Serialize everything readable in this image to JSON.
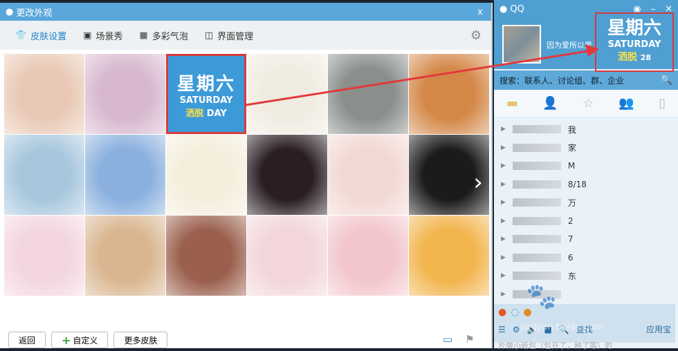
{
  "skin_window": {
    "title": "更改外观",
    "close": "x",
    "tabs": [
      {
        "label": "皮肤设置",
        "icon": "shirt-icon"
      },
      {
        "label": "场景秀",
        "icon": "image-icon"
      },
      {
        "label": "多彩气泡",
        "icon": "bubble-icon"
      },
      {
        "label": "界面管理",
        "icon": "layout-icon"
      }
    ],
    "selected_skin": {
      "line1": "星期六",
      "line2": "SATURDAY",
      "line3a": "洒脱",
      "line3b": " DAY"
    },
    "tiles": [
      "#e9c9b6",
      "#d7b8cf",
      "#3d9ad9",
      "#f1ece2",
      "#8a8f8c",
      "#d48848",
      "#a8c7dd",
      "#8ab0de",
      "#f4eedc",
      "#2a1e24",
      "#f2d8d3",
      "#1b1b1b",
      "#f3d6de",
      "#d9b690",
      "#9a5f4d",
      "#f2d6da",
      "#f2c6cc",
      "#f2b44c"
    ],
    "buttons": {
      "back": "返回",
      "custom": "自定义",
      "more": "更多皮肤"
    }
  },
  "qq": {
    "title": "QQ",
    "signature": "因为爱所以爱",
    "level": "28",
    "skin": {
      "line1": "星期六",
      "line2": "SATURDAY",
      "line3": "洒脱"
    },
    "search_placeholder": "搜索：联系人、讨论组、群、企业",
    "groups": [
      "我",
      "家",
      "M",
      "8/18",
      "万",
      "2",
      "7",
      "6",
      "东",
      ""
    ],
    "bottom_find": "查找",
    "bottom_app": "应用宝"
  },
  "watermark": {
    "logo": "Baidu经验",
    "url": "jingyan.baidu.com"
  },
  "under_text": "片做小纸包（包开了，种了等）的",
  "accent": "#5aa7db",
  "highlight": "#d9393c"
}
